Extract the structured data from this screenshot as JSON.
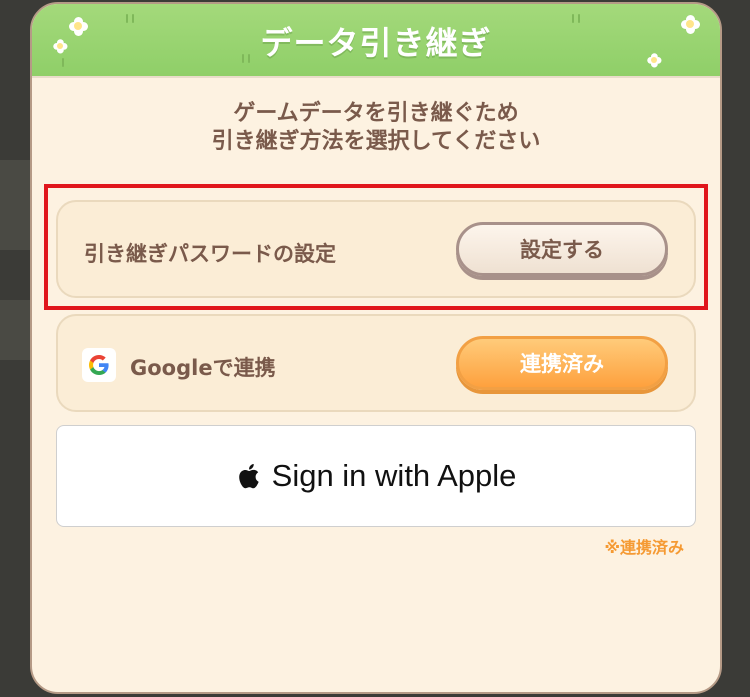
{
  "dialog": {
    "title": "データ引き継ぎ",
    "instructions": [
      "ゲームデータを引き継ぐため",
      "引き継ぎ方法を選択してください"
    ]
  },
  "options": {
    "password": {
      "label": "引き継ぎパスワードの設定",
      "button_label": "設定する"
    },
    "google": {
      "label": "Googleで連携",
      "button_label": "連携済み",
      "icon": "google-logo-icon"
    },
    "apple": {
      "button_label": "Sign in with Apple",
      "icon": "apple-logo-icon",
      "note": "※連携済み"
    }
  },
  "colors": {
    "header_green": "#9dd674",
    "panel_bg": "#fdf2e1",
    "text_brown": "#7a5a4b",
    "accent_orange": "#fea13e",
    "highlight_red": "#e0161c"
  }
}
